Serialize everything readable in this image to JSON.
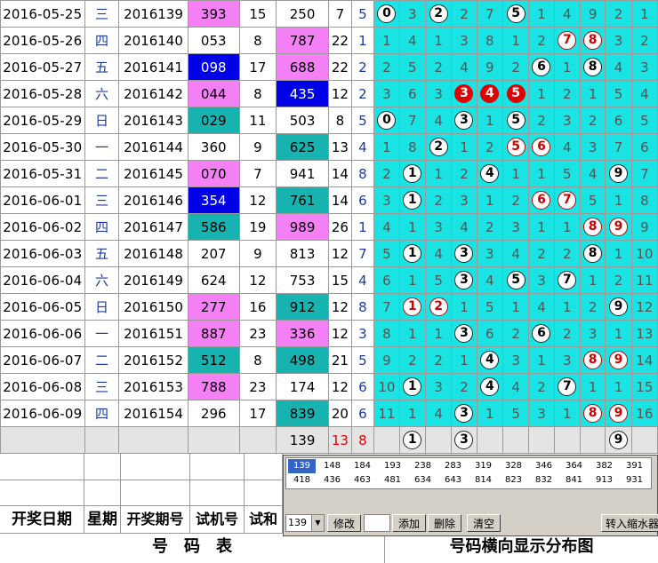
{
  "rows": [
    {
      "date": "2016-05-25",
      "weekday": "三",
      "issue": "2016139",
      "trial": "393",
      "trial_bg": "magenta",
      "trial_sum": "15",
      "draw": "250",
      "draw_bg": "",
      "span": "7",
      "c": "5",
      "cells": [
        [
          "b",
          "0"
        ],
        [
          "n",
          "3"
        ],
        [
          "b",
          "2"
        ],
        [
          "n",
          "2"
        ],
        [
          "n",
          "7"
        ],
        [
          "b",
          "5"
        ],
        [
          "n",
          "1"
        ],
        [
          "n",
          "4"
        ],
        [
          "n",
          "9"
        ],
        [
          "n",
          "2"
        ],
        [
          "n",
          "1"
        ]
      ]
    },
    {
      "date": "2016-05-26",
      "weekday": "四",
      "issue": "2016140",
      "trial": "053",
      "trial_bg": "",
      "trial_sum": "8",
      "draw": "787",
      "draw_bg": "magenta",
      "span": "22",
      "c": "1",
      "cells": [
        [
          "n",
          "1"
        ],
        [
          "n",
          "4"
        ],
        [
          "n",
          "1"
        ],
        [
          "n",
          "3"
        ],
        [
          "n",
          "8"
        ],
        [
          "n",
          "1"
        ],
        [
          "n",
          "2"
        ],
        [
          "r",
          "7"
        ],
        [
          "r",
          "8"
        ],
        [
          "n",
          "3"
        ],
        [
          "n",
          "2"
        ]
      ]
    },
    {
      "date": "2016-05-27",
      "weekday": "五",
      "issue": "2016141",
      "trial": "098",
      "trial_bg": "blue",
      "trial_sum": "17",
      "draw": "688",
      "draw_bg": "magenta",
      "span": "22",
      "c": "2",
      "cells": [
        [
          "n",
          "2"
        ],
        [
          "n",
          "5"
        ],
        [
          "n",
          "2"
        ],
        [
          "n",
          "4"
        ],
        [
          "n",
          "9"
        ],
        [
          "n",
          "2"
        ],
        [
          "b",
          "6"
        ],
        [
          "n",
          "1"
        ],
        [
          "b",
          "8"
        ],
        [
          "n",
          "4"
        ],
        [
          "n",
          "3"
        ]
      ]
    },
    {
      "date": "2016-05-28",
      "weekday": "六",
      "issue": "2016142",
      "trial": "044",
      "trial_bg": "magenta",
      "trial_sum": "8",
      "draw": "435",
      "draw_bg": "blue",
      "span": "12",
      "c": "2",
      "cells": [
        [
          "n",
          "3"
        ],
        [
          "n",
          "6"
        ],
        [
          "n",
          "3"
        ],
        [
          "f",
          "3"
        ],
        [
          "f",
          "4"
        ],
        [
          "f",
          "5"
        ],
        [
          "n",
          "1"
        ],
        [
          "n",
          "2"
        ],
        [
          "n",
          "1"
        ],
        [
          "n",
          "5"
        ],
        [
          "n",
          "4"
        ]
      ]
    },
    {
      "date": "2016-05-29",
      "weekday": "日",
      "issue": "2016143",
      "trial": "029",
      "trial_bg": "teal",
      "trial_sum": "11",
      "draw": "503",
      "draw_bg": "",
      "span": "8",
      "c": "5",
      "cells": [
        [
          "b",
          "0"
        ],
        [
          "n",
          "7"
        ],
        [
          "n",
          "4"
        ],
        [
          "b",
          "3"
        ],
        [
          "n",
          "1"
        ],
        [
          "b",
          "5"
        ],
        [
          "n",
          "2"
        ],
        [
          "n",
          "3"
        ],
        [
          "n",
          "2"
        ],
        [
          "n",
          "6"
        ],
        [
          "n",
          "5"
        ]
      ]
    },
    {
      "date": "2016-05-30",
      "weekday": "一",
      "issue": "2016144",
      "trial": "360",
      "trial_bg": "",
      "trial_sum": "9",
      "draw": "625",
      "draw_bg": "teal",
      "span": "13",
      "c": "4",
      "cells": [
        [
          "n",
          "1"
        ],
        [
          "n",
          "8"
        ],
        [
          "b",
          "2"
        ],
        [
          "n",
          "1"
        ],
        [
          "n",
          "2"
        ],
        [
          "r",
          "5"
        ],
        [
          "r",
          "6"
        ],
        [
          "n",
          "4"
        ],
        [
          "n",
          "3"
        ],
        [
          "n",
          "7"
        ],
        [
          "n",
          "6"
        ]
      ]
    },
    {
      "date": "2016-05-31",
      "weekday": "二",
      "issue": "2016145",
      "trial": "070",
      "trial_bg": "magenta",
      "trial_sum": "7",
      "draw": "941",
      "draw_bg": "",
      "span": "14",
      "c": "8",
      "cells": [
        [
          "n",
          "2"
        ],
        [
          "b",
          "1"
        ],
        [
          "n",
          "1"
        ],
        [
          "n",
          "2"
        ],
        [
          "b",
          "4"
        ],
        [
          "n",
          "1"
        ],
        [
          "n",
          "1"
        ],
        [
          "n",
          "5"
        ],
        [
          "n",
          "4"
        ],
        [
          "b",
          "9"
        ],
        [
          "n",
          "7"
        ]
      ]
    },
    {
      "date": "2016-06-01",
      "weekday": "三",
      "issue": "2016146",
      "trial": "354",
      "trial_bg": "blue",
      "trial_sum": "12",
      "draw": "761",
      "draw_bg": "teal",
      "span": "14",
      "c": "6",
      "cells": [
        [
          "n",
          "3"
        ],
        [
          "b",
          "1"
        ],
        [
          "n",
          "2"
        ],
        [
          "n",
          "3"
        ],
        [
          "n",
          "1"
        ],
        [
          "n",
          "2"
        ],
        [
          "r",
          "6"
        ],
        [
          "r",
          "7"
        ],
        [
          "n",
          "5"
        ],
        [
          "n",
          "1"
        ],
        [
          "n",
          "8"
        ]
      ]
    },
    {
      "date": "2016-06-02",
      "weekday": "四",
      "issue": "2016147",
      "trial": "586",
      "trial_bg": "teal",
      "trial_sum": "19",
      "draw": "989",
      "draw_bg": "magenta",
      "span": "26",
      "c": "1",
      "cells": [
        [
          "n",
          "4"
        ],
        [
          "n",
          "1"
        ],
        [
          "n",
          "3"
        ],
        [
          "n",
          "4"
        ],
        [
          "n",
          "2"
        ],
        [
          "n",
          "3"
        ],
        [
          "n",
          "1"
        ],
        [
          "n",
          "1"
        ],
        [
          "r",
          "8"
        ],
        [
          "r",
          "9"
        ],
        [
          "n",
          "9"
        ]
      ]
    },
    {
      "date": "2016-06-03",
      "weekday": "五",
      "issue": "2016148",
      "trial": "207",
      "trial_bg": "",
      "trial_sum": "9",
      "draw": "813",
      "draw_bg": "",
      "span": "12",
      "c": "7",
      "cells": [
        [
          "n",
          "5"
        ],
        [
          "b",
          "1"
        ],
        [
          "n",
          "4"
        ],
        [
          "b",
          "3"
        ],
        [
          "n",
          "3"
        ],
        [
          "n",
          "4"
        ],
        [
          "n",
          "2"
        ],
        [
          "n",
          "2"
        ],
        [
          "b",
          "8"
        ],
        [
          "n",
          "1"
        ],
        [
          "n",
          "10"
        ]
      ]
    },
    {
      "date": "2016-06-04",
      "weekday": "六",
      "issue": "2016149",
      "trial": "624",
      "trial_bg": "",
      "trial_sum": "12",
      "draw": "753",
      "draw_bg": "",
      "span": "15",
      "c": "4",
      "cells": [
        [
          "n",
          "6"
        ],
        [
          "n",
          "1"
        ],
        [
          "n",
          "5"
        ],
        [
          "b",
          "3"
        ],
        [
          "n",
          "4"
        ],
        [
          "b",
          "5"
        ],
        [
          "n",
          "3"
        ],
        [
          "b",
          "7"
        ],
        [
          "n",
          "1"
        ],
        [
          "n",
          "2"
        ],
        [
          "n",
          "11"
        ]
      ]
    },
    {
      "date": "2016-06-05",
      "weekday": "日",
      "issue": "2016150",
      "trial": "277",
      "trial_bg": "magenta",
      "trial_sum": "16",
      "draw": "912",
      "draw_bg": "teal",
      "span": "12",
      "c": "8",
      "cells": [
        [
          "n",
          "7"
        ],
        [
          "r",
          "1"
        ],
        [
          "r",
          "2"
        ],
        [
          "n",
          "1"
        ],
        [
          "n",
          "5"
        ],
        [
          "n",
          "1"
        ],
        [
          "n",
          "4"
        ],
        [
          "n",
          "1"
        ],
        [
          "n",
          "2"
        ],
        [
          "b",
          "9"
        ],
        [
          "n",
          "12"
        ]
      ]
    },
    {
      "date": "2016-06-06",
      "weekday": "一",
      "issue": "2016151",
      "trial": "887",
      "trial_bg": "magenta",
      "trial_sum": "23",
      "draw": "336",
      "draw_bg": "magenta",
      "span": "12",
      "c": "3",
      "cells": [
        [
          "n",
          "8"
        ],
        [
          "n",
          "1"
        ],
        [
          "n",
          "1"
        ],
        [
          "b",
          "3"
        ],
        [
          "n",
          "6"
        ],
        [
          "n",
          "2"
        ],
        [
          "b",
          "6"
        ],
        [
          "n",
          "2"
        ],
        [
          "n",
          "3"
        ],
        [
          "n",
          "1"
        ],
        [
          "n",
          "13"
        ]
      ]
    },
    {
      "date": "2016-06-07",
      "weekday": "二",
      "issue": "2016152",
      "trial": "512",
      "trial_bg": "teal",
      "trial_sum": "8",
      "draw": "498",
      "draw_bg": "teal",
      "span": "21",
      "c": "5",
      "cells": [
        [
          "n",
          "9"
        ],
        [
          "n",
          "2"
        ],
        [
          "n",
          "2"
        ],
        [
          "n",
          "1"
        ],
        [
          "b",
          "4"
        ],
        [
          "n",
          "3"
        ],
        [
          "n",
          "1"
        ],
        [
          "n",
          "3"
        ],
        [
          "r",
          "8"
        ],
        [
          "r",
          "9"
        ],
        [
          "n",
          "14"
        ]
      ]
    },
    {
      "date": "2016-06-08",
      "weekday": "三",
      "issue": "2016153",
      "trial": "788",
      "trial_bg": "magenta",
      "trial_sum": "23",
      "draw": "174",
      "draw_bg": "",
      "span": "12",
      "c": "6",
      "cells": [
        [
          "n",
          "10"
        ],
        [
          "b",
          "1"
        ],
        [
          "n",
          "3"
        ],
        [
          "n",
          "2"
        ],
        [
          "b",
          "4"
        ],
        [
          "n",
          "4"
        ],
        [
          "n",
          "2"
        ],
        [
          "b",
          "7"
        ],
        [
          "n",
          "1"
        ],
        [
          "n",
          "1"
        ],
        [
          "n",
          "15"
        ]
      ]
    },
    {
      "date": "2016-06-09",
      "weekday": "四",
      "issue": "2016154",
      "trial": "296",
      "trial_bg": "",
      "trial_sum": "17",
      "draw": "839",
      "draw_bg": "teal",
      "span": "20",
      "c": "6",
      "cells": [
        [
          "n",
          "11"
        ],
        [
          "n",
          "1"
        ],
        [
          "n",
          "4"
        ],
        [
          "b",
          "3"
        ],
        [
          "n",
          "1"
        ],
        [
          "n",
          "5"
        ],
        [
          "n",
          "3"
        ],
        [
          "n",
          "1"
        ],
        [
          "r",
          "8"
        ],
        [
          "r",
          "9"
        ],
        [
          "n",
          "16"
        ]
      ]
    }
  ],
  "next_row": {
    "draw": "139",
    "span": "13",
    "c": "8",
    "cells": [
      [
        "e",
        ""
      ],
      [
        "b",
        "1"
      ],
      [
        "e",
        ""
      ],
      [
        "b",
        "3"
      ],
      [
        "e",
        ""
      ],
      [
        "e",
        ""
      ],
      [
        "e",
        ""
      ],
      [
        "e",
        ""
      ],
      [
        "e",
        ""
      ],
      [
        "b",
        "9"
      ],
      [
        "e",
        ""
      ]
    ]
  },
  "headers": {
    "date": "开奖日期",
    "weekday": "星期",
    "issue": "开奖期号",
    "trial": "试机号",
    "trial_sum": "试和"
  },
  "titles": {
    "left": "号　码　表",
    "right": "号码横向显示分布图"
  },
  "panel": {
    "list_items": [
      "139",
      "148",
      "184",
      "193",
      "238",
      "283",
      "319",
      "328",
      "346",
      "364",
      "382",
      "391",
      "418",
      "436",
      "463",
      "481",
      "634",
      "643",
      "814",
      "823",
      "832",
      "841",
      "913",
      "931"
    ],
    "selected_value": "139",
    "modify_label": "修改",
    "add_label": "添加",
    "delete_label": "删除",
    "clear_label": "清空",
    "import_label": "转入缩水器"
  },
  "colors": {
    "magenta": "#f57ff5",
    "blue": "#0000e8",
    "teal": "#17b3b0",
    "cyan_grid": "#19e3e3",
    "red_ball": "#e00000"
  }
}
